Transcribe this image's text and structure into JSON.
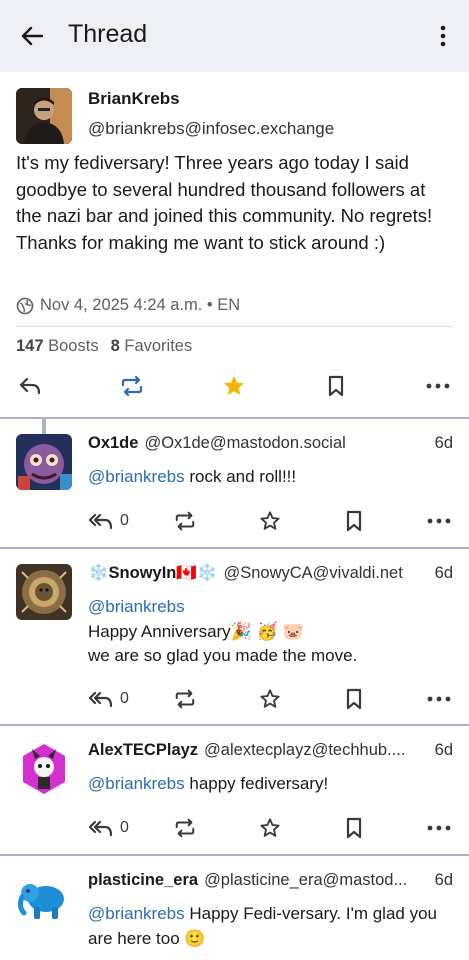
{
  "appbar": {
    "title": "Thread"
  },
  "main_post": {
    "name": "BrianKrebs",
    "handle": "@briankrebs@infosec.exchange",
    "text": "It's my fediversary! Three years ago today I said goodbye to several hundred thousand followers at the nazi bar and joined this community. No regrets! Thanks for making me want to stick around :)",
    "meta": "Nov 4, 2025 4:24 a.m. • EN",
    "boosts_count": "147",
    "boosts_label": "Boosts",
    "favorites_count": "8",
    "favorites_label": "Favorites"
  },
  "replies": [
    {
      "name": "Ox1de",
      "handle": "@Ox1de@mastodon.social",
      "time": "6d",
      "mention": "@briankrebs",
      "text_inline": " rock and roll!!!",
      "lines": [],
      "reply_count": "0"
    },
    {
      "name": "❄️SnowyIn🇨🇦❄️",
      "handle": "@SnowyCA@vivaldi.net",
      "time": "6d",
      "mention": "@briankrebs",
      "text_inline": "",
      "lines": [
        "Happy Anniversary🎉 🥳 🐷",
        "we are so glad you made the move."
      ],
      "reply_count": "0"
    },
    {
      "name": "AlexTECPlayz",
      "handle": "@alextecplayz@techhub....",
      "time": "6d",
      "mention": "@briankrebs",
      "text_inline": " happy fediversary!",
      "lines": [],
      "reply_count": "0"
    },
    {
      "name": "plasticine_era",
      "handle": "@plasticine_era@mastod...",
      "time": "6d",
      "mention": "@briankrebs",
      "text_inline": " Happy Fedi-versary. I'm glad you are here too 🙂",
      "lines": [],
      "reply_count": ""
    }
  ],
  "colors": {
    "accent": "#2b6cb5",
    "star": "#f5b400",
    "separator": "#a8b1c9",
    "appbar": "#eef0f6"
  }
}
